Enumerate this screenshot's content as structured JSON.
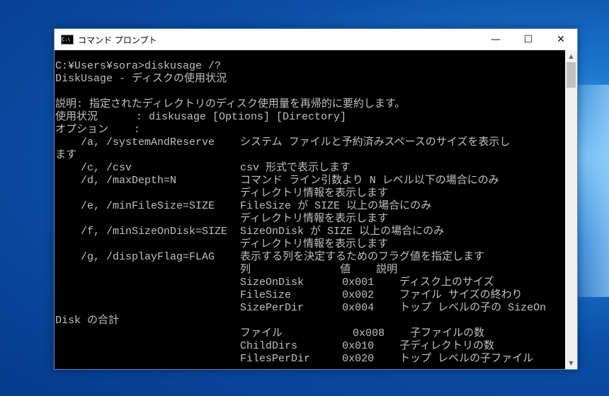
{
  "window": {
    "title": "コマンド プロンプト",
    "icon_text": "C:\\"
  },
  "controls": {
    "minimize": "—",
    "maximize": "☐",
    "close": "✕"
  },
  "scrollbar": {
    "up": "▲",
    "down": "▼"
  },
  "console": {
    "lines": [
      "C:¥Users¥sora>diskusage /?",
      "DiskUsage - ディスクの使用状況",
      "",
      "説明: 指定されたディレクトリのディスク使用量を再帰的に要約します。",
      "使用状況      : diskusage [Options] [Directory]",
      "オプション    :",
      "    /a, /systemAndReserve    システム ファイルと予約済みスペースのサイズを表示し",
      "ます",
      "    /c, /csv                 csv 形式で表示します",
      "    /d, /maxDepth=N          コマンド ライン引数より N レベル以下の場合にのみ",
      "                             ディレクトリ情報を表示します",
      "    /e, /minFileSize=SIZE    FileSize が SIZE 以上の場合にのみ",
      "                             ディレクトリ情報を表示します",
      "    /f, /minSizeOnDisk=SIZE  SizeOnDisk が SIZE 以上の場合にのみ",
      "                             ディレクトリ情報を表示します",
      "    /g, /displayFlag=FLAG    表示する列を決定するためのフラグ値を指定します",
      "                             列              値    説明",
      "                             SizeOnDisk      0x001    ディスク上のサイズ",
      "                             FileSize        0x002    ファイル サイズの終わり",
      "                             SizePerDir      0x004    トップ レベルの子の SizeOn",
      "Disk の合計",
      "                             ファイル           0x008    子ファイルの数",
      "                             ChildDirs       0x010    子ディレクトリの数",
      "                             FilesPerDir     0x020    トップ レベルの子ファイル"
    ]
  }
}
